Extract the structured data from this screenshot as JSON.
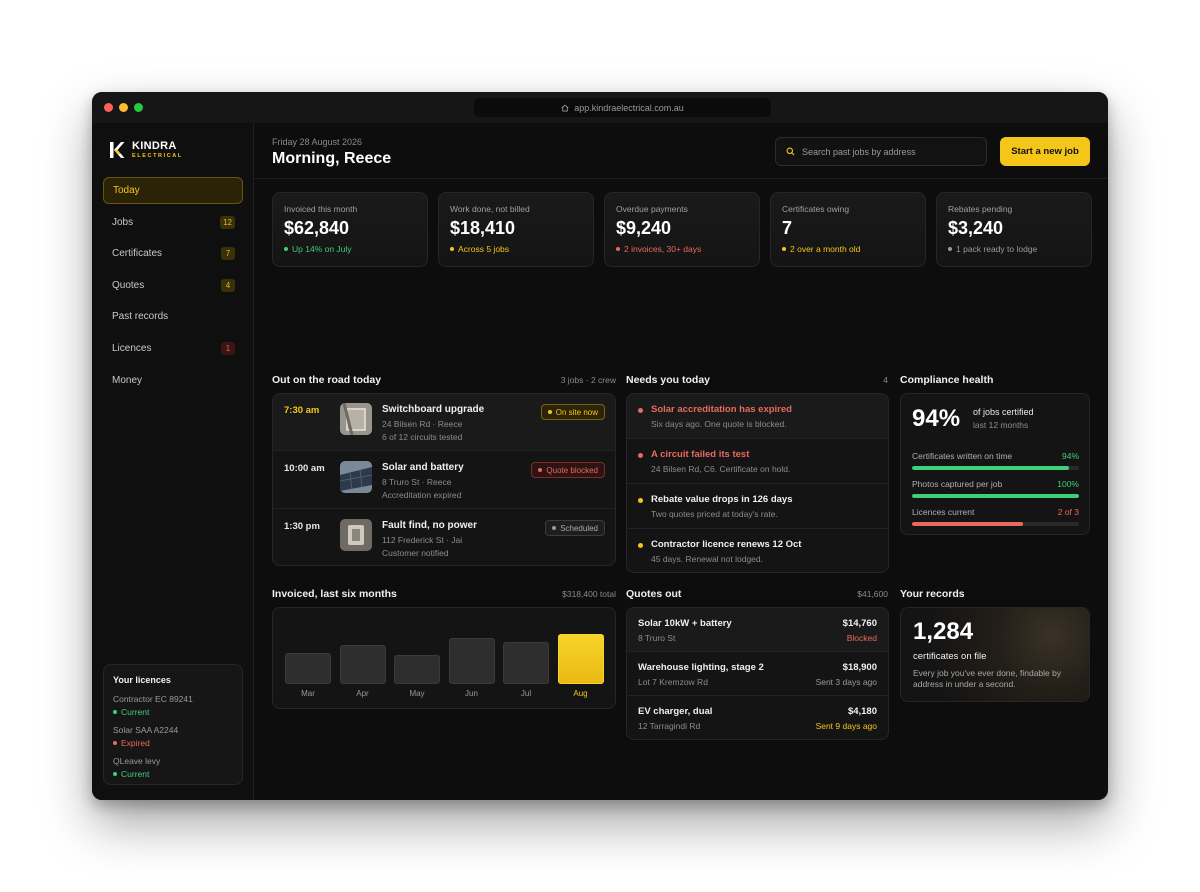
{
  "browser": {
    "url": "app.kindraelectrical.com.au"
  },
  "brand": {
    "name": "KINDRA",
    "sub": "ELECTRICAL",
    "accent": "#f5c61a"
  },
  "nav": [
    {
      "label": "Today",
      "badge": "",
      "active": true
    },
    {
      "label": "Jobs",
      "badge": "12",
      "badge_kind": "amber"
    },
    {
      "label": "Certificates",
      "badge": "7",
      "badge_kind": "amber"
    },
    {
      "label": "Quotes",
      "badge": "4",
      "badge_kind": "amber"
    },
    {
      "label": "Past records",
      "badge": ""
    },
    {
      "label": "Licences",
      "badge": "1",
      "badge_kind": "red"
    },
    {
      "label": "Money",
      "badge": ""
    }
  ],
  "licences": {
    "title": "Your licences",
    "items": [
      {
        "name": "Contractor EC 89241",
        "status": "Current",
        "color": "#3ecf7a"
      },
      {
        "name": "Solar SAA A2244",
        "status": "Expired",
        "color": "#e86a5e"
      },
      {
        "name": "QLeave levy",
        "status": "Current",
        "color": "#3ecf7a"
      }
    ]
  },
  "header": {
    "date": "Friday 28 August 2026",
    "greeting": "Morning, Reece",
    "search_placeholder": "Search past jobs by address",
    "cta": "Start a new job"
  },
  "stats": [
    {
      "label": "Invoiced this month",
      "value": "$62,840",
      "note": "Up 14% on July",
      "color": "#3ecf7a"
    },
    {
      "label": "Work done, not billed",
      "value": "$18,410",
      "note": "Across 5 jobs",
      "color": "#f5c61a"
    },
    {
      "label": "Overdue payments",
      "value": "$9,240",
      "note": "2 invoices, 30+ days",
      "color": "#e86a5e"
    },
    {
      "label": "Certificates owing",
      "value": "7",
      "note": "2 over a month old",
      "color": "#f5c61a"
    },
    {
      "label": "Rebates pending",
      "value": "$3,240",
      "note": "1 pack ready to lodge",
      "color": "#9a9a9a"
    }
  ],
  "road": {
    "title": "Out on the road today",
    "meta": "3 jobs · 2 crew",
    "jobs": [
      {
        "time": "7:30 am",
        "title": "Switchboard upgrade",
        "address": "24 Bilsen Rd · Reece",
        "detail": "6 of 12 circuits tested",
        "status": "On site now",
        "kind": "onsite"
      },
      {
        "time": "10:00 am",
        "title": "Solar and battery",
        "address": "8 Truro St · Reece",
        "detail": "Accreditation expired",
        "status": "Quote blocked",
        "kind": "blocked"
      },
      {
        "time": "1:30 pm",
        "title": "Fault find, no power",
        "address": "112 Frederick St · Jai",
        "detail": "Customer notified",
        "status": "Scheduled",
        "kind": "sched"
      }
    ]
  },
  "needs": {
    "title": "Needs you today",
    "count": "4",
    "items": [
      {
        "title": "Solar accreditation has expired",
        "sub": "Six days ago. One quote is blocked.",
        "color": "#e86a5e"
      },
      {
        "title": "A circuit failed its test",
        "sub": "24 Bilsen Rd, C6. Certificate on hold.",
        "color": "#e86a5e"
      },
      {
        "title": "Rebate value drops in 126 days",
        "sub": "Two quotes priced at today's rate.",
        "color": "#f5c61a"
      },
      {
        "title": "Contractor licence renews 12 Oct",
        "sub": "45 days. Renewal not lodged.",
        "color": "#f5c61a"
      }
    ]
  },
  "compliance": {
    "title": "Compliance health",
    "value": "94%",
    "of": "of jobs certified",
    "sub": "last 12 months",
    "metrics": [
      {
        "label": "Certificates written on time",
        "value": "94%",
        "fraction": 0.94,
        "color": "#3ecf7a"
      },
      {
        "label": "Photos captured per job",
        "value": "100%",
        "fraction": 1.0,
        "color": "#3ecf7a"
      },
      {
        "label": "Licences current",
        "value": "2 of 3",
        "fraction": 0.6667,
        "color": "#e86a5e"
      }
    ]
  },
  "chart_data": {
    "type": "bar",
    "title": "Invoiced, last six months",
    "total": "$318,400 total",
    "categories": [
      "Mar",
      "Apr",
      "May",
      "Jun",
      "Jul",
      "Aug"
    ],
    "values": [
      43000,
      54000,
      40000,
      63000,
      58000,
      69000
    ],
    "highlight": "Aug"
  },
  "quotes": {
    "title": "Quotes out",
    "total": "$41,600",
    "items": [
      {
        "title": "Solar 10kW + battery",
        "address": "8 Truro St",
        "amount": "$14,760",
        "status": "Blocked",
        "color": "#e86a5e"
      },
      {
        "title": "Warehouse lighting, stage 2",
        "address": "Lot 7 Kremzow Rd",
        "amount": "$18,900",
        "status": "Sent 3 days ago",
        "color": "#9a9a9a"
      },
      {
        "title": "EV charger, dual",
        "address": "12 Tarragindi Rd",
        "amount": "$4,180",
        "status": "Sent 9 days ago",
        "color": "#f5c61a"
      }
    ]
  },
  "records": {
    "title": "Your records",
    "value": "1,284",
    "label": "certificates on file",
    "desc": "Every job you've ever done, findable by address in under a second."
  }
}
